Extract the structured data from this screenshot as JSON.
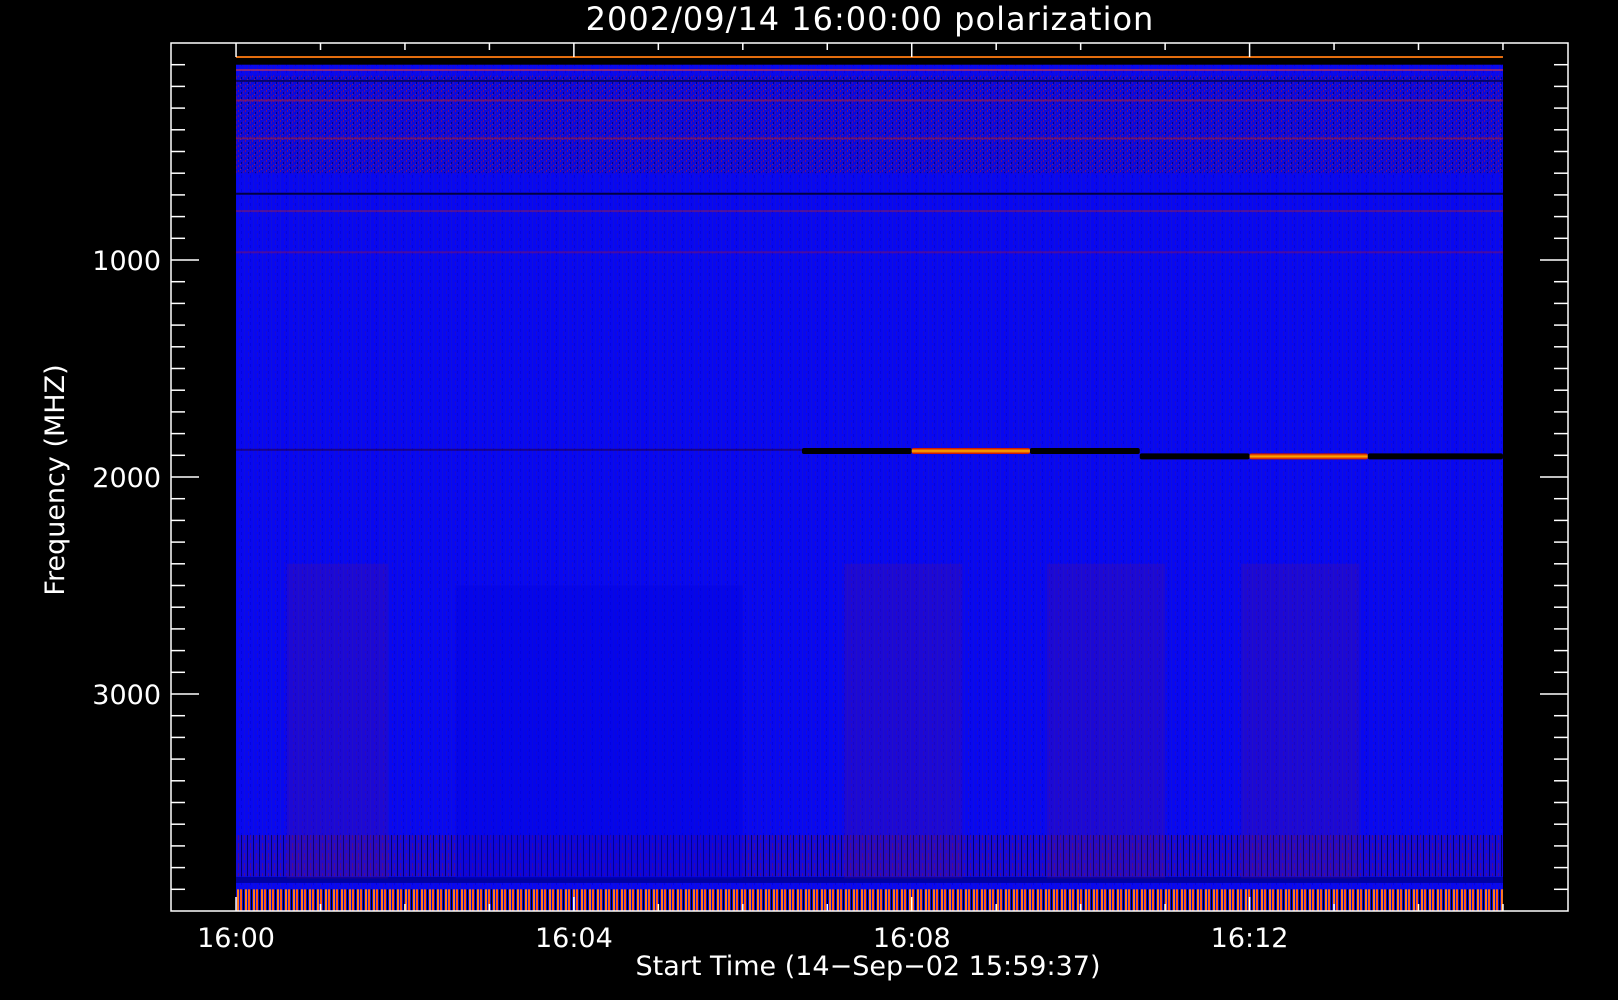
{
  "chart_data": {
    "type": "heatmap",
    "title": "2002/09/14 16:00:00 polarization",
    "xlabel": "Start Time (14−Sep−02 15:59:37)",
    "ylabel": "Frequency (MHZ)",
    "x_ticks": [
      "16:00",
      "16:04",
      "16:08",
      "16:12"
    ],
    "x_tick_minutes": [
      0,
      4,
      8,
      12
    ],
    "xlim_minutes": [
      -0.77,
      15.77
    ],
    "data_x_range_minutes": [
      0,
      15
    ],
    "y_ticks": [
      1000,
      2000,
      3000
    ],
    "ylim": [
      4000,
      0
    ],
    "data_y_range": [
      100,
      4000
    ],
    "grid": false,
    "colormap": {
      "background": "#0808f0",
      "dark": "#000000",
      "mid": "#c81010",
      "hot": "#ffa000"
    },
    "features": [
      {
        "name": "band emission segment",
        "t_start": 6.7,
        "t_end": 8.0,
        "freq": 1880,
        "intensity": "dark"
      },
      {
        "name": "band emission segment",
        "t_start": 8.0,
        "t_end": 9.4,
        "freq": 1880,
        "intensity": "hot"
      },
      {
        "name": "band emission segment",
        "t_start": 9.4,
        "t_end": 10.7,
        "freq": 1880,
        "intensity": "dark"
      },
      {
        "name": "band emission segment",
        "t_start": 10.7,
        "t_end": 12.0,
        "freq": 1905,
        "intensity": "dark"
      },
      {
        "name": "band emission segment",
        "t_start": 12.0,
        "t_end": 13.4,
        "freq": 1905,
        "intensity": "hot"
      },
      {
        "name": "band emission segment",
        "t_start": 13.4,
        "t_end": 15.0,
        "freq": 1905,
        "intensity": "dark"
      }
    ]
  }
}
